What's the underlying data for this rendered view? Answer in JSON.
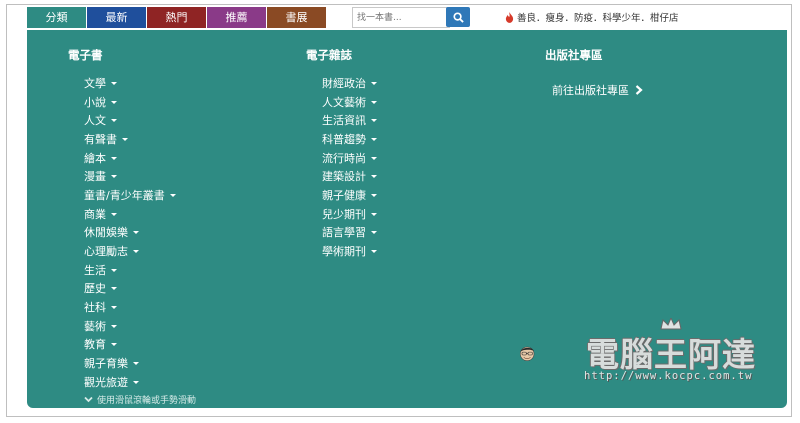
{
  "nav": {
    "tabs": [
      {
        "label": "分類",
        "color": "#2e8b83"
      },
      {
        "label": "最新",
        "color": "#1f4f9c"
      },
      {
        "label": "熱門",
        "color": "#8f2424"
      },
      {
        "label": "推薦",
        "color": "#8a3a88"
      },
      {
        "label": "書展",
        "color": "#8a4a24"
      }
    ]
  },
  "search": {
    "placeholder": "找一本書..."
  },
  "hot_keywords": "善良．瘦身．防疫．科學少年．柑仔店",
  "columns": {
    "ebooks": {
      "title": "電子書",
      "items": [
        "文學",
        "小說",
        "人文",
        "有聲書",
        "繪本",
        "漫畫",
        "童書/青少年叢書",
        "商業",
        "休閒娛樂",
        "心理勵志",
        "生活",
        "歷史",
        "社科",
        "藝術",
        "教育",
        "親子育樂",
        "觀光旅遊"
      ]
    },
    "magazines": {
      "title": "電子雜誌",
      "items": [
        "財經政治",
        "人文藝術",
        "生活資訊",
        "科普趨勢",
        "流行時尚",
        "建築設計",
        "親子健康",
        "兒少期刊",
        "語言學習",
        "學術期刊"
      ]
    },
    "publishers": {
      "title": "出版社專區",
      "link": "前往出版社專區"
    }
  },
  "scroll_hint": "使用滑鼠滾輪或手勢滑動",
  "watermark": {
    "title": "電腦王阿達",
    "url": "http://www.kocpc.com.tw"
  }
}
